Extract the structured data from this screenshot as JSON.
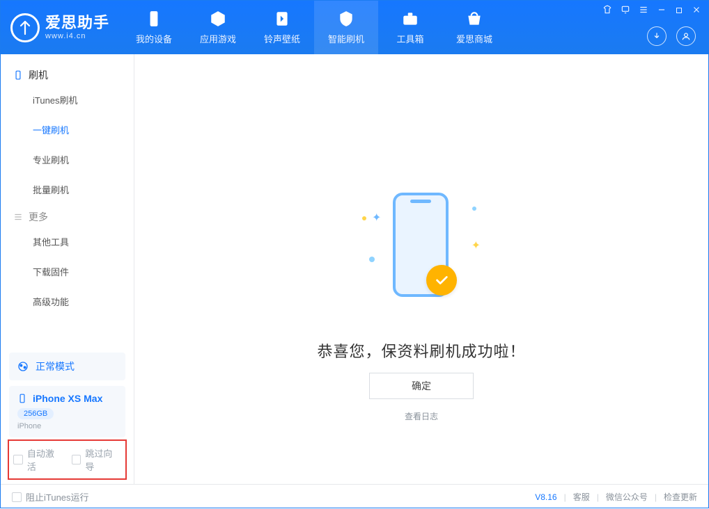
{
  "brand": {
    "title": "爱思助手",
    "subtitle": "www.i4.cn"
  },
  "nav": {
    "tabs": [
      {
        "label": "我的设备"
      },
      {
        "label": "应用游戏"
      },
      {
        "label": "铃声壁纸"
      },
      {
        "label": "智能刷机"
      },
      {
        "label": "工具箱"
      },
      {
        "label": "爱思商城"
      }
    ],
    "active_index": 3
  },
  "sidebar": {
    "group1_label": "刷机",
    "group1_items": [
      "iTunes刷机",
      "一键刷机",
      "专业刷机",
      "批量刷机"
    ],
    "group1_active_index": 1,
    "group2_label": "更多",
    "group2_items": [
      "其他工具",
      "下载固件",
      "高级功能"
    ],
    "mode": {
      "label": "正常模式"
    },
    "device": {
      "name": "iPhone XS Max",
      "storage": "256GB",
      "platform": "iPhone"
    },
    "checks": {
      "auto_activate": "自动激活",
      "skip_guide": "跳过向导"
    }
  },
  "main": {
    "success_text": "恭喜您，保资料刷机成功啦！",
    "ok_label": "确定",
    "log_label": "查看日志"
  },
  "status": {
    "block_itunes": "阻止iTunes运行",
    "version": "V8.16",
    "links": [
      "客服",
      "微信公众号",
      "检查更新"
    ]
  }
}
